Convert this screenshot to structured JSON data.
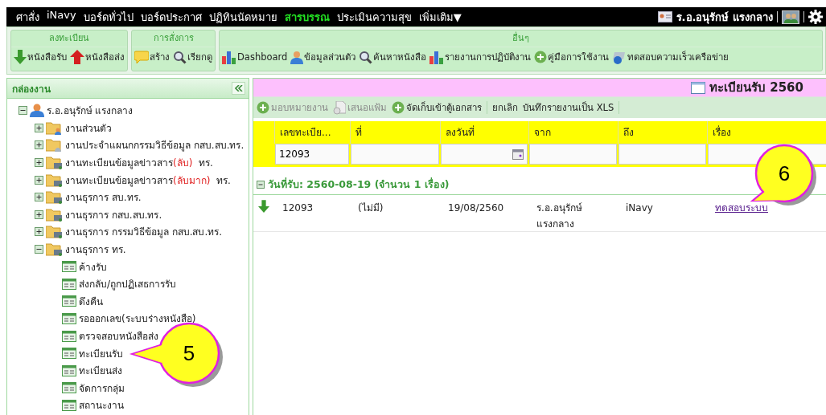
{
  "menu": {
    "items": [
      {
        "label": "ศาสั่ง",
        "selected": false
      },
      {
        "label": "iNavy",
        "selected": false
      },
      {
        "label": "บอร์ดทั่วไป",
        "selected": false
      },
      {
        "label": "บอร์ดประกาศ",
        "selected": false
      },
      {
        "label": "ปฏิทินนัดหมาย",
        "selected": false
      },
      {
        "label": "สารบรรณ",
        "selected": true
      },
      {
        "label": "ประเมินความสุข",
        "selected": false
      },
      {
        "label": "เพิ่มเติม▼",
        "selected": false
      }
    ],
    "user": "ร.อ.อนุรักษ์ แรงกลาง"
  },
  "toolbar": [
    {
      "title": "ลงทะเบียน",
      "items": [
        {
          "label": "หนังสือรับ",
          "kind": "down"
        },
        {
          "label": "หนังสือส่ง",
          "kind": "up"
        }
      ]
    },
    {
      "title": "การสั่งการ",
      "items": [
        {
          "label": "สร้าง",
          "kind": "note"
        },
        {
          "label": "เรียกดู",
          "kind": "search"
        }
      ]
    },
    {
      "title": "อื่นๆ",
      "items": [
        {
          "label": "Dashboard",
          "kind": "chart"
        },
        {
          "label": "ข้อมูลส่วนตัว",
          "kind": "person"
        },
        {
          "label": "ค้นหาหนังสือ",
          "kind": "search"
        },
        {
          "label": "รายงานการปฏิบัติงาน",
          "kind": "chart"
        },
        {
          "label": "คู่มือการใช้งาน",
          "kind": "plus"
        },
        {
          "label": "ทดสอบความเร็วเครือข่าย",
          "kind": "network"
        }
      ]
    }
  ],
  "sidebar": {
    "title": "กล่องงาน",
    "tree": [
      {
        "label": "ร.อ.อนุรักษ์ แรงกลาง",
        "kind": "person",
        "expanded": true,
        "children": [
          {
            "label": "งานส่วนตัว",
            "kind": "folder-person",
            "expanded": false
          },
          {
            "label": "งานประจำแผนกกรรมวิธีข้อมูล กสบ.สบ.ทร.",
            "kind": "folder-grey",
            "expanded": false
          },
          {
            "label": "งานทะเบียนข้อมูลข่าวสาร",
            "tag": "(ลับ)",
            "suffix": "ทร.",
            "kind": "folder-net",
            "expanded": false
          },
          {
            "label": "งานทะเบียนข้อมูลข่าวสาร",
            "tag": "(ลับมาก)",
            "suffix": "ทร.",
            "kind": "folder-net",
            "expanded": false
          },
          {
            "label": "งานธุรการ สบ.ทร.",
            "kind": "folder-net",
            "expanded": false
          },
          {
            "label": "งานธุรการ กสบ.สบ.ทร.",
            "kind": "folder-net",
            "expanded": false
          },
          {
            "label": "งานธุรการ กรรมวิธีข้อมูล กสบ.สบ.ทร.",
            "kind": "folder-net",
            "expanded": false
          },
          {
            "label": "งานธุรการ ทร.",
            "kind": "folder-net",
            "expanded": true,
            "children": [
              {
                "label": "ค้างรับ",
                "kind": "list"
              },
              {
                "label": "ส่งกลับ/ถูกปฏิเสธการรับ",
                "kind": "list"
              },
              {
                "label": "ดึงคืน",
                "kind": "list"
              },
              {
                "label": "รอออกเลข(ระบบร่างหนังสือ)",
                "kind": "list"
              },
              {
                "label": "ตรวจสอบหนังสือส่ง",
                "kind": "list"
              },
              {
                "label": "ทะเบียนรับ",
                "kind": "list"
              },
              {
                "label": "ทะเบียนส่ง",
                "kind": "list"
              },
              {
                "label": "จัดการกลุ่ม",
                "kind": "list"
              },
              {
                "label": "สถานะงาน",
                "kind": "list"
              }
            ]
          }
        ]
      }
    ]
  },
  "panel": {
    "title": "ทะเบียนรับ 2560",
    "actions": [
      {
        "label": "มอบหมายงาน",
        "kind": "plus",
        "disabled": true
      },
      {
        "label": "เสนอแฟ้ม",
        "kind": "file",
        "disabled": true
      },
      {
        "label": "จัดเก็บเข้าตู้เอกสาร",
        "kind": "plus",
        "disabled": false
      },
      {
        "label": "ยกเลิก",
        "kind": "text",
        "disabled": false
      },
      {
        "label": "บันทึกรายงานเป็น XLS",
        "kind": "text",
        "disabled": false
      }
    ],
    "columns": [
      {
        "label": "เลขทะเบีย...",
        "filter": "12093",
        "kind": "text"
      },
      {
        "label": "ที่",
        "kind": "text"
      },
      {
        "label": "ลงวันที่",
        "kind": "date"
      },
      {
        "label": "จาก",
        "kind": "text"
      },
      {
        "label": "ถึง",
        "kind": "text"
      },
      {
        "label": "เรื่อง",
        "kind": "text"
      }
    ],
    "group": "วันที่รับ: 2560-08-19 (จำนวน 1 เรื่อง)",
    "rows": [
      {
        "cells": [
          "12093",
          "(ไม่มี)",
          "19/08/2560",
          "ร.อ.อนุรักษ์ แรงกลาง",
          "iNavy",
          "ทดสอบระบบ"
        ]
      }
    ]
  },
  "callouts": [
    {
      "number": "5"
    },
    {
      "number": "6"
    }
  ]
}
